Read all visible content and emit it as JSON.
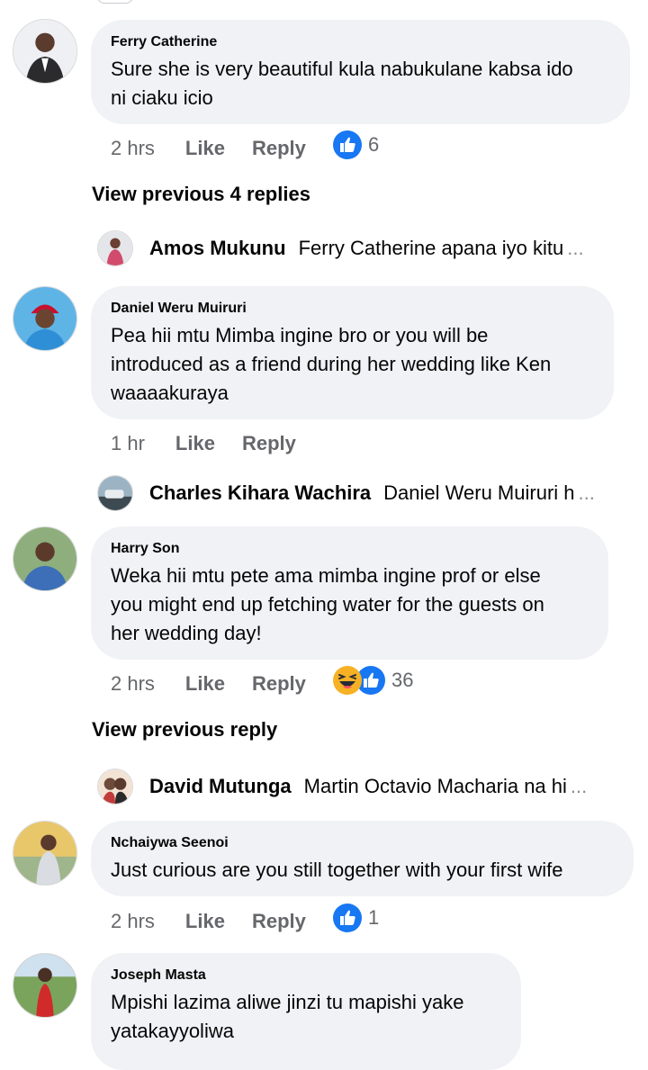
{
  "comments": [
    {
      "author": "Ferry Catherine",
      "lines": [
        "Sure she is very beautiful kula nabukulane kabsa ido",
        "ni ciaku icio"
      ],
      "time": "2 hrs",
      "like": "Like",
      "reply": "Reply",
      "reaction_count": "6",
      "reactions": [
        "like-icon"
      ]
    },
    {
      "author": "Daniel Weru Muiruri",
      "lines": [
        "Pea hii mtu Mimba ingine bro or you will be",
        "introduced as a friend during her wedding like Ken",
        "waaaakuraya"
      ],
      "time": "1 hr",
      "like": "Like",
      "reply": "Reply"
    },
    {
      "author": "Harry Son",
      "lines": [
        "Weka hii mtu pete ama mimba ingine prof or else",
        "you might end up fetching water for the guests on",
        "her wedding day!"
      ],
      "time": "2 hrs",
      "like": "Like",
      "reply": "Reply",
      "reaction_count": "36",
      "reactions": [
        "haha-icon",
        "like-icon"
      ]
    },
    {
      "author": "Nchaiywa Seenoi",
      "lines": [
        "Just curious are you still together with your first wife"
      ],
      "time": "2 hrs",
      "like": "Like",
      "reply": "Reply",
      "reaction_count": "1",
      "reactions": [
        "like-icon"
      ]
    },
    {
      "author": "Joseph Masta",
      "lines": [
        "Mpishi lazima aliwe jinzi tu mapishi yake",
        "yatakayyoliwa"
      ]
    }
  ],
  "view_previous": [
    "View previous 4 replies",
    "View previous reply"
  ],
  "replies": [
    {
      "author": "Amos Mukunu",
      "text": "Ferry Catherine apana iyo kitu",
      "ellipsis": "..."
    },
    {
      "author": "Charles Kihara Wachira",
      "text": "Daniel Weru Muiruri h",
      "ellipsis": "..."
    },
    {
      "author": "David Mutunga",
      "text": "Martin Octavio Macharia na hi",
      "ellipsis": "..."
    }
  ],
  "colors": {
    "bubble": "#f0f2f5",
    "meta": "#65676b",
    "like_blue": "#1877f2",
    "haha_yellow": "#f7b125"
  }
}
